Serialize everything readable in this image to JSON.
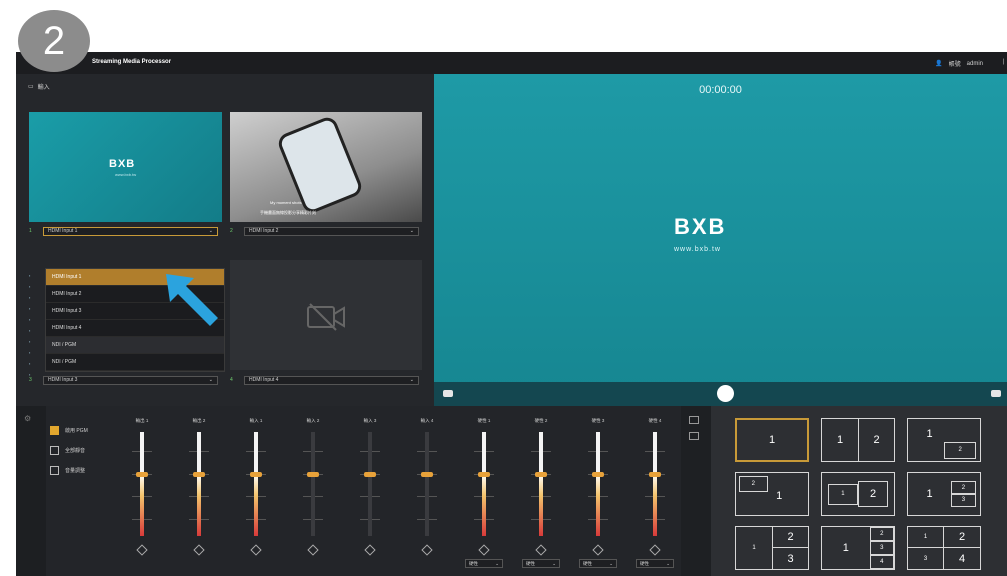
{
  "step_badge": "2",
  "titlebar": {
    "title": "Streaming Media Processor",
    "user_icon": "user-icon",
    "user_label": "帳號",
    "username": "admin",
    "end_text": "|"
  },
  "sources": {
    "header_icon": "camera-icon",
    "header_label": "輸入",
    "thumb1_logo": "BXB",
    "thumb1_sub": "www.bxb.tw",
    "thumb2_caption1": "My moment shots",
    "thumb2_caption2": "手機畫面無線投影分享精彩片刻",
    "slot1": {
      "index": "1",
      "value": "HDMI Input 1"
    },
    "slot2": {
      "index": "2",
      "value": "HDMI Input 2"
    },
    "slot3": {
      "index": "3",
      "value": "HDMI Input 3"
    },
    "slot4": {
      "index": "4",
      "value": "HDMI Input 4"
    },
    "dropdown_options": [
      "HDMI Input 1",
      "HDMI Input 2",
      "HDMI Input 3",
      "HDMI Input 4",
      "NDI / PGM",
      "NDI / PGM"
    ]
  },
  "preview": {
    "timecode": "00:00:00",
    "logo": "BXB",
    "url": "www.bxb.tw"
  },
  "mixer": {
    "options": [
      {
        "label": "啟用 PGM",
        "checked": true
      },
      {
        "label": "全部靜音",
        "checked": false
      },
      {
        "label": "音量調整",
        "checked": false
      }
    ],
    "channels": [
      {
        "label": "輸出 1",
        "level": 0.6,
        "active": true,
        "select": ""
      },
      {
        "label": "輸出 2",
        "level": 0.6,
        "active": true,
        "select": ""
      },
      {
        "label": "輸入 1",
        "level": 0.6,
        "active": true,
        "select": ""
      },
      {
        "label": "輸入 2",
        "level": 0.6,
        "active": false,
        "select": ""
      },
      {
        "label": "輸入 3",
        "level": 0.6,
        "active": false,
        "select": ""
      },
      {
        "label": "輸入 4",
        "level": 0.6,
        "active": false,
        "select": ""
      },
      {
        "label": "硬性 1",
        "level": 0.6,
        "active": true,
        "select": "硬性"
      },
      {
        "label": "硬性 2",
        "level": 0.6,
        "active": true,
        "select": "硬性"
      },
      {
        "label": "硬性 3",
        "level": 0.6,
        "active": true,
        "select": "硬性"
      },
      {
        "label": "硬性 4",
        "level": 0.6,
        "active": true,
        "select": "硬性"
      }
    ]
  },
  "layouts": {
    "l1": "1",
    "l2a": "1",
    "l2b": "2",
    "l3a": "1",
    "l3b": "2",
    "l4a": "2",
    "l4b": "1",
    "l5a": "1",
    "l5b": "2",
    "l6a": "1",
    "l6b": "2",
    "l6c": "3",
    "l7a": "1",
    "l7b": "2",
    "l7c": "3",
    "l8a": "1",
    "l8b": "2",
    "l8c": "3",
    "l8d": "4",
    "l9a": "1",
    "l9b": "2",
    "l9c": "3",
    "l9d": "4"
  },
  "colors": {
    "accent": "#c89a38",
    "preview_bg": "#1e9aa6",
    "fader_red": "#d83a3a"
  }
}
